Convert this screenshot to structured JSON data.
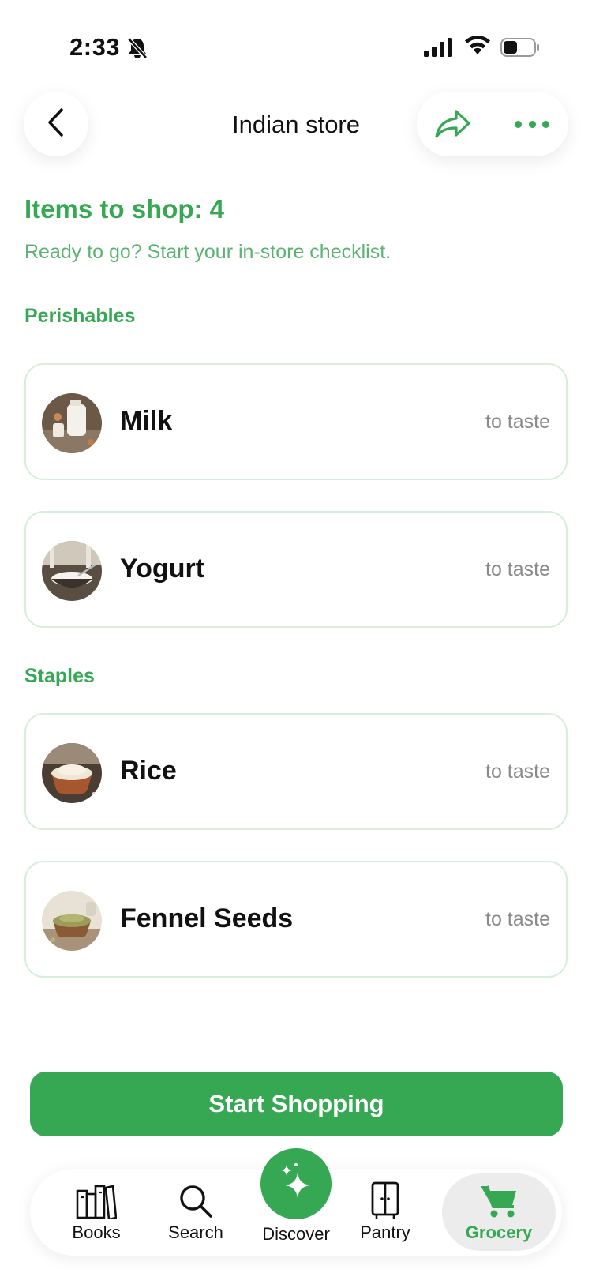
{
  "status_bar": {
    "time": "2:33"
  },
  "nav": {
    "title": "Indian store"
  },
  "summary": {
    "heading": "Items to shop: 4",
    "subtitle": "Ready to go? Start your in-store checklist."
  },
  "sections": [
    {
      "label": "Perishables",
      "items": [
        {
          "name": "Milk",
          "qty": "to taste"
        },
        {
          "name": "Yogurt",
          "qty": "to taste"
        }
      ]
    },
    {
      "label": "Staples",
      "items": [
        {
          "name": "Rice",
          "qty": "to taste"
        },
        {
          "name": "Fennel Seeds",
          "qty": "to taste"
        }
      ]
    }
  ],
  "start_button": {
    "label": "Start Shopping"
  },
  "tabs": [
    {
      "label": "Books",
      "icon": "books-icon"
    },
    {
      "label": "Search",
      "icon": "search-icon"
    },
    {
      "label": "Discover",
      "icon": "sparkle-icon"
    },
    {
      "label": "Pantry",
      "icon": "pantry-icon"
    },
    {
      "label": "Grocery",
      "icon": "cart-icon",
      "active": true
    }
  ],
  "colors": {
    "accent": "#36a854",
    "card_border": "#d7eedd",
    "muted": "#8a8a8a"
  }
}
